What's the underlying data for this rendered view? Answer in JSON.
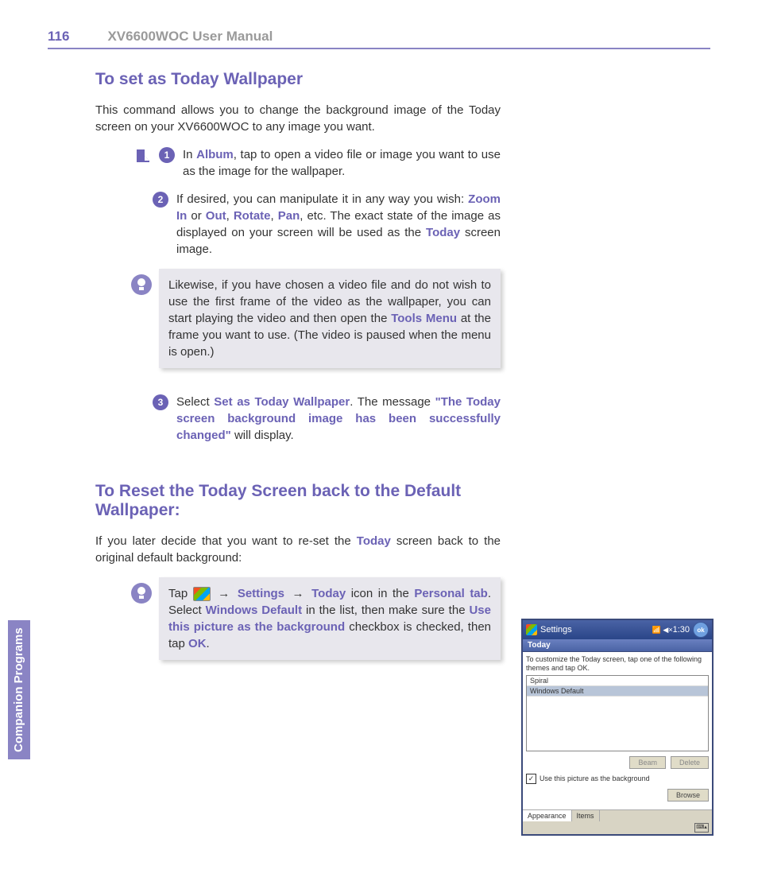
{
  "header": {
    "page_number": "116",
    "manual_title": "XV6600WOC User Manual"
  },
  "side_label": "Companion Programs",
  "section1": {
    "heading": "To set as Today Wallpaper",
    "intro": "This command allows you to change the background image of the Today screen on your XV6600WOC to any image you want.",
    "step1_pre": "In ",
    "step1_hl1": "Album",
    "step1_post": ", tap to open a video file or image you want to use as the image for the wallpaper.",
    "step2_pre": "If desired, you can manipulate it in any way you wish: ",
    "step2_hl1": "Zoom In",
    "step2_mid1": " or ",
    "step2_hl2": "Out",
    "step2_mid2": ", ",
    "step2_hl3": "Rotate",
    "step2_mid3": ", ",
    "step2_hl4": "Pan",
    "step2_mid4": ", etc. The exact state of the image as displayed on your screen will be used as the ",
    "step2_hl5": "Today",
    "step2_post": " screen image.",
    "tip1_pre": "Likewise, if you have chosen a video file and do not wish to use the first frame of the video as the wallpaper, you can start playing the video and then open the ",
    "tip1_hl": "Tools Menu",
    "tip1_post": " at the frame you want to use. (The video is paused when the menu is open.)",
    "step3_pre": "Select ",
    "step3_hl1": "Set as Today Wallpaper",
    "step3_mid": ". The message ",
    "step3_hl2": "\"The Today screen background image has been successfully changed\"",
    "step3_post": " will display."
  },
  "section2": {
    "heading": "To Reset the Today Screen back to the Default Wallpaper:",
    "intro_pre": "If you later decide that you want to re-set the ",
    "intro_hl": "Today",
    "intro_post": " screen back to the original default background:",
    "tip_t1": "Tap ",
    "tip_t2": " → ",
    "tip_hl1": "Settings",
    "tip_t3": " → ",
    "tip_hl2": "Today",
    "tip_t4": " icon in the ",
    "tip_hl3": "Personal tab",
    "tip_t5": ". Select ",
    "tip_hl4": "Windows Default",
    "tip_t6": " in the list, then make sure the ",
    "tip_hl5": "Use this picture as the background",
    "tip_t7": " checkbox is checked, then tap ",
    "tip_hl6": "OK",
    "tip_t8": "."
  },
  "screenshot": {
    "title": "Settings",
    "time": "1:30",
    "ok": "ok",
    "today": "Today",
    "desc": "To customize the Today screen, tap one of the following themes and tap OK.",
    "list": [
      "Spiral",
      "Windows Default"
    ],
    "btn_beam": "Beam",
    "btn_delete": "Delete",
    "check_label": "Use this picture as the background",
    "btn_browse": "Browse",
    "tabs": [
      "Appearance",
      "Items"
    ]
  }
}
